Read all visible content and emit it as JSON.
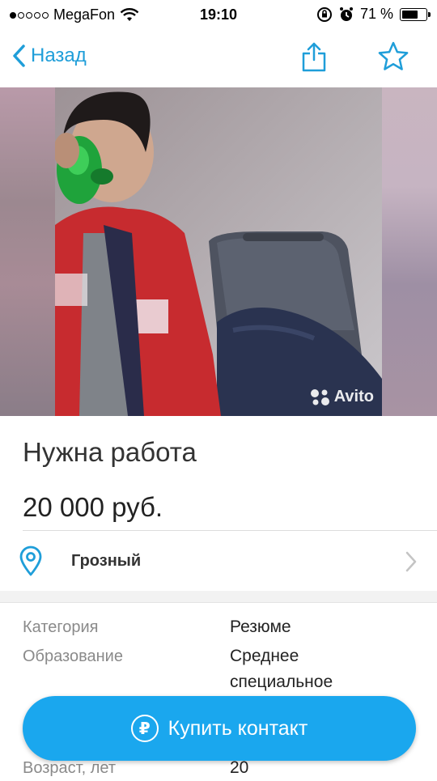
{
  "status_bar": {
    "carrier": "MegaFon",
    "time": "19:10",
    "battery_percent": "71 %",
    "battery_level": 0.71
  },
  "nav": {
    "back_label": "Назад",
    "share_icon": "share-icon",
    "favorite_icon": "star-icon"
  },
  "photo": {
    "watermark": "Avito"
  },
  "listing": {
    "title": "Нужна работа",
    "price": "20 000 руб.",
    "city": "Грозный"
  },
  "params": [
    {
      "label": "Категория",
      "value": "Резюме"
    },
    {
      "label": "Образование",
      "value": "Среднее\nспециальное"
    },
    {
      "label": "Возраст, лет",
      "value": "20"
    }
  ],
  "buy_button": {
    "label": "Купить контакт",
    "icon": "₽"
  },
  "colors": {
    "accent": "#1f9ed9",
    "button": "#1aa7ee"
  }
}
